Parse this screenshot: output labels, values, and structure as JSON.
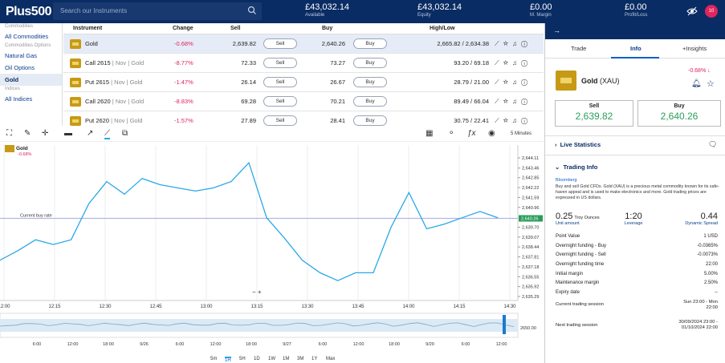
{
  "header": {
    "logo": "Plus500",
    "search_placeholder": "Search our Instruments",
    "stats": [
      {
        "value": "£43,032.14",
        "label": "Available"
      },
      {
        "value": "£43,032.14",
        "label": "Equity"
      },
      {
        "value": "£0.00",
        "label": "M. Margin"
      },
      {
        "value": "£0.00",
        "label": "Profit/Loss"
      }
    ],
    "avatar": "10"
  },
  "sidebar": {
    "items": [
      {
        "type": "section",
        "label": "Commodities"
      },
      {
        "type": "item",
        "label": "All Commodities"
      },
      {
        "type": "section",
        "label": "Commodities Options"
      },
      {
        "type": "item",
        "label": "Natural Gas"
      },
      {
        "type": "item",
        "label": "Oil Options"
      },
      {
        "type": "item",
        "label": "Gold",
        "active": true
      },
      {
        "type": "section",
        "label": "Indices"
      },
      {
        "type": "item",
        "label": "All Indices"
      }
    ]
  },
  "table": {
    "headers": {
      "instrument": "Instrument",
      "change": "Change",
      "sell": "Sell",
      "buy": "Buy",
      "highlow": "High/Low"
    },
    "sell_btn": "Sell",
    "buy_btn": "Buy",
    "rows": [
      {
        "name": "Gold",
        "sub": "",
        "change": "-0.68%",
        "sell": "2,639.82",
        "buy": "2,640.26",
        "highlow": "2,665.82 / 2,634.38",
        "sel": true
      },
      {
        "name": "Call 2615",
        "sub": " | Nov | Gold",
        "change": "-8.77%",
        "sell": "72.33",
        "buy": "73.27",
        "highlow": "93.20 / 69.18"
      },
      {
        "name": "Put 2615",
        "sub": " | Nov | Gold",
        "change": "-1.47%",
        "sell": "26.14",
        "buy": "26.67",
        "highlow": "28.79 / 21.00"
      },
      {
        "name": "Call 2620",
        "sub": " | Nov | Gold",
        "change": "-8.83%",
        "sell": "69.28",
        "buy": "70.21",
        "highlow": "89.49 / 66.04"
      },
      {
        "name": "Put 2620",
        "sub": " | Nov | Gold",
        "change": "-1.57%",
        "sell": "27.89",
        "buy": "28.41",
        "highlow": "30.75 / 22.41"
      }
    ]
  },
  "chart": {
    "instrument": "Gold",
    "change": "-0.68%",
    "interval": "5 Minutes",
    "buy_line_label": "Current buy rate",
    "current_price": "2,640.26",
    "timeframes": [
      "5m",
      "1H",
      "5H",
      "1D",
      "1W",
      "1M",
      "3M",
      "1Y",
      "Max"
    ],
    "active_timeframe": "1H",
    "nav_level": "2650.00",
    "nav_ticks": [
      "6:00",
      "12:00",
      "18:00",
      "9/26",
      "6:00",
      "12:00",
      "18:00",
      "9/27",
      "6:00",
      "12:00",
      "18:00",
      "9/29",
      "6:00",
      "12:00"
    ]
  },
  "chart_data": {
    "type": "line",
    "x": [
      "12:00",
      "12:05",
      "12:10",
      "12:15",
      "12:20",
      "12:25",
      "12:30",
      "12:35",
      "12:40",
      "12:45",
      "12:50",
      "12:55",
      "13:00",
      "13:05",
      "13:10",
      "13:15",
      "13:20",
      "13:25",
      "13:30",
      "13:35",
      "13:40",
      "13:45",
      "13:50",
      "13:55",
      "14:00",
      "14:05",
      "14:10",
      "14:15",
      "14:20",
      "14:25",
      "14:30"
    ],
    "values": [
      2637.6,
      2638.2,
      2638.9,
      2638.6,
      2638.9,
      2641.2,
      2642.6,
      2641.8,
      2642.8,
      2642.4,
      2642.2,
      2642.0,
      2642.2,
      2642.6,
      2643.8,
      2640.3,
      2639.0,
      2637.6,
      2636.8,
      2636.3,
      2636.8,
      2636.8,
      2639.7,
      2641.9,
      2639.6,
      2639.9,
      2640.3,
      2640.7,
      2640.3
    ],
    "ylabels": [
      "2,644.11",
      "2,643.46",
      "2,642.85",
      "2,642.22",
      "2,641.59",
      "2,640.96",
      "2,639.70",
      "2,639.07",
      "2,638.44",
      "2,637.81",
      "2,637.18",
      "2,636.55",
      "2,635.92",
      "2,635.29"
    ],
    "ylim": [
      2635.29,
      2644.11
    ],
    "xticks": [
      "12:00",
      "12:15",
      "12:30",
      "12:45",
      "13:00",
      "13:15",
      "13:30",
      "13:45",
      "14:00",
      "14:15",
      "14:30"
    ]
  },
  "rp": {
    "tabs": [
      "Trade",
      "Info",
      "+Insights"
    ],
    "active": "Info",
    "name": "Gold",
    "symbol": "(XAU)",
    "change": "-0.68%",
    "sell_label": "Sell",
    "sell_price": "2,639.82",
    "buy_label": "Buy",
    "buy_price": "2,640.26",
    "live_stats": "Live Statistics",
    "trading_info": "Trading Info",
    "source": "Bloomberg",
    "desc": "Buy and sell Gold CFDs. Gold (XAU) is a precious metal commodity known for its safe-haven appeal and is used to make electronics and more. Gold trading prices are expressed in US dollars.",
    "unit_amount": "0.25",
    "unit_label": "Unit amount",
    "unit_suffix": "Troy Ounces",
    "leverage": "1:20",
    "leverage_label": "Leverage",
    "spread": "0.44",
    "spread_label": "Dynamic Spread",
    "details": [
      {
        "k": "Point Value",
        "v": "1 USD"
      },
      {
        "k": "Overnight funding - Buy",
        "v": "-0.0365%"
      },
      {
        "k": "Overnight funding - Sell",
        "v": "-0.0073%"
      },
      {
        "k": "Overnight funding time",
        "v": "22:00"
      },
      {
        "k": "Initial margin",
        "v": "5.00%"
      },
      {
        "k": "Maintenance margin",
        "v": "2.50%"
      },
      {
        "k": "Expiry date",
        "v": "--"
      }
    ],
    "session_cur_label": "Current trading session",
    "session_cur": "Sun 23:00 - Mon 22:00",
    "session_next_label": "Next trading session",
    "session_next": "30/09/2024 23:00 - 01/10/2024 22:00"
  },
  "colors": {
    "brand": "#0a2c64",
    "line": "#29a8e8",
    "neg": "#e0245e",
    "pos": "#2a9d5a"
  }
}
